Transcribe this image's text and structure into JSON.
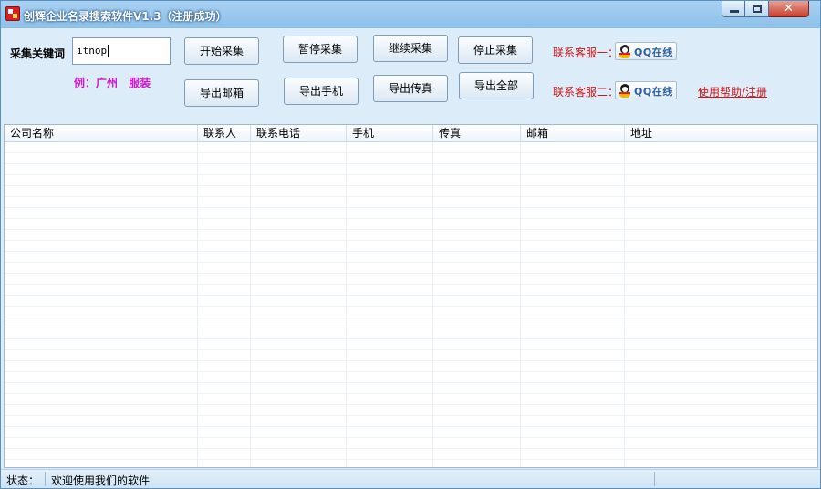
{
  "window": {
    "title": "创辉企业名录搜索软件V1.3（注册成功）"
  },
  "search": {
    "label": "采集关键词",
    "value": "itnop",
    "example": "例：广州 服装"
  },
  "buttons": {
    "start": "开始采集",
    "pause": "暂停采集",
    "resume": "继续采集",
    "stop": "停止采集",
    "export_email": "导出邮箱",
    "export_mobile": "导出手机",
    "export_fax": "导出传真",
    "export_all": "导出全部"
  },
  "support": {
    "cs1_label": "联系客服一：",
    "cs2_label": "联系客服二：",
    "qq_text": "QQ在线",
    "help_link": "使用帮助/注册"
  },
  "table": {
    "columns": [
      "公司名称",
      "联系人",
      "联系电话",
      "手机",
      "传真",
      "邮箱",
      "地址"
    ]
  },
  "status": {
    "label": "状态：",
    "message": "欢迎使用我们的软件"
  },
  "icons": {
    "app": "app-logo-icon",
    "qq": "qq-penguin-icon"
  },
  "colors": {
    "accent_red": "#d01818",
    "example_magenta": "#d018d0",
    "titlebar": "#8cc0ea"
  }
}
